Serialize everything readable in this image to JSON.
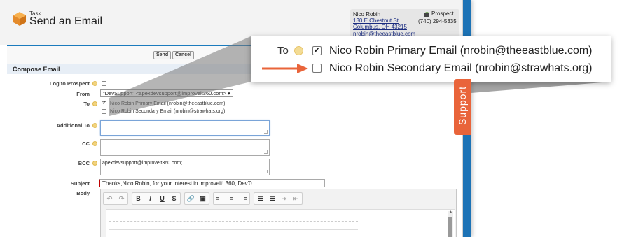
{
  "header": {
    "caption": "Task",
    "title": "Send an Email"
  },
  "contact": {
    "name": "Nico Robin",
    "address_line1": "130 E Chestnut St",
    "address_line2": "Columbus, OH 43215",
    "email": "nrobin@theeastblue.com",
    "type": "Prospect",
    "phone": "(740) 294-5335"
  },
  "buttons": {
    "send": "Send",
    "cancel": "Cancel"
  },
  "section": {
    "title": "Compose Email"
  },
  "form": {
    "log_label": "Log to Prospect",
    "from_label": "From",
    "from_value": "\"DevSupport\" <apexdevsupport@improveit360.com>",
    "to_label": "To",
    "to_options": [
      {
        "label": "Nico Robin Primary Email (nrobin@theeastblue.com)",
        "checked": true
      },
      {
        "label": "Nico Robin Secondary Email (nrobin@strawhats.org)",
        "checked": false
      }
    ],
    "additional_to_label": "Additional To",
    "additional_to_value": "",
    "cc_label": "CC",
    "cc_value": "",
    "bcc_label": "BCC",
    "bcc_value": "apexdevsupport@improveit360.com;",
    "subject_label": "Subject",
    "subject_value": "Thanks,Nico Robin, for your Interest in improveit! 360, Dev'0",
    "body_label": "Body"
  },
  "toolbar": {
    "undo": "↶",
    "redo": "↷",
    "bold": "B",
    "italic": "I",
    "underline": "U",
    "strike": "S",
    "link": "🔗",
    "image": "▣",
    "align_left": "≡",
    "align_center": "≡",
    "align_right": "≡",
    "bullets": "☰",
    "numbers": "☷",
    "indent": "⇥",
    "outdent": "⇤"
  },
  "zoom": {
    "to_label": "To",
    "primary": "Nico Robin Primary Email (nrobin@theeastblue.com)",
    "secondary": "Nico Robin Secondary Email (nrobin@strawhats.org)",
    "checkmark": "✔"
  },
  "support_tab": {
    "label": "Support"
  },
  "colors": {
    "accent_blue": "#1b7bbd",
    "arrow": "#e9643a",
    "support_tab": "#e9643a",
    "required": "#c00000"
  }
}
